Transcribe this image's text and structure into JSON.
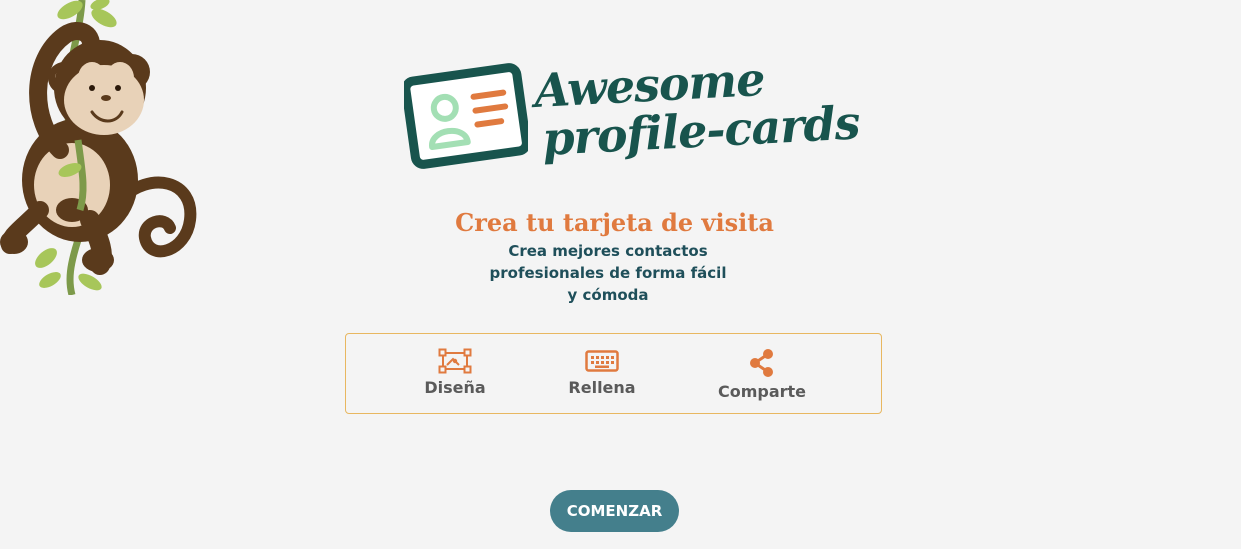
{
  "logo": {
    "line1": "Awesome",
    "line2": "profile-cards"
  },
  "hero": {
    "title": "Crea tu tarjeta de visita",
    "subtitle": "Crea mejores contactos profesionales de forma fácil y cómoda"
  },
  "steps": [
    {
      "label": "Diseña",
      "icon": "design-icon"
    },
    {
      "label": "Rellena",
      "icon": "keyboard-icon"
    },
    {
      "label": "Comparte",
      "icon": "share-icon"
    }
  ],
  "cta": {
    "label": "COMENZAR"
  },
  "colors": {
    "background": "#f4f4f4",
    "brand_dark": "#18544d",
    "accent_orange": "#e07a3f",
    "text_dark": "#1f4f5a",
    "border": "#e8b760",
    "button": "#447f8c",
    "mint": "#a3dfb4"
  }
}
